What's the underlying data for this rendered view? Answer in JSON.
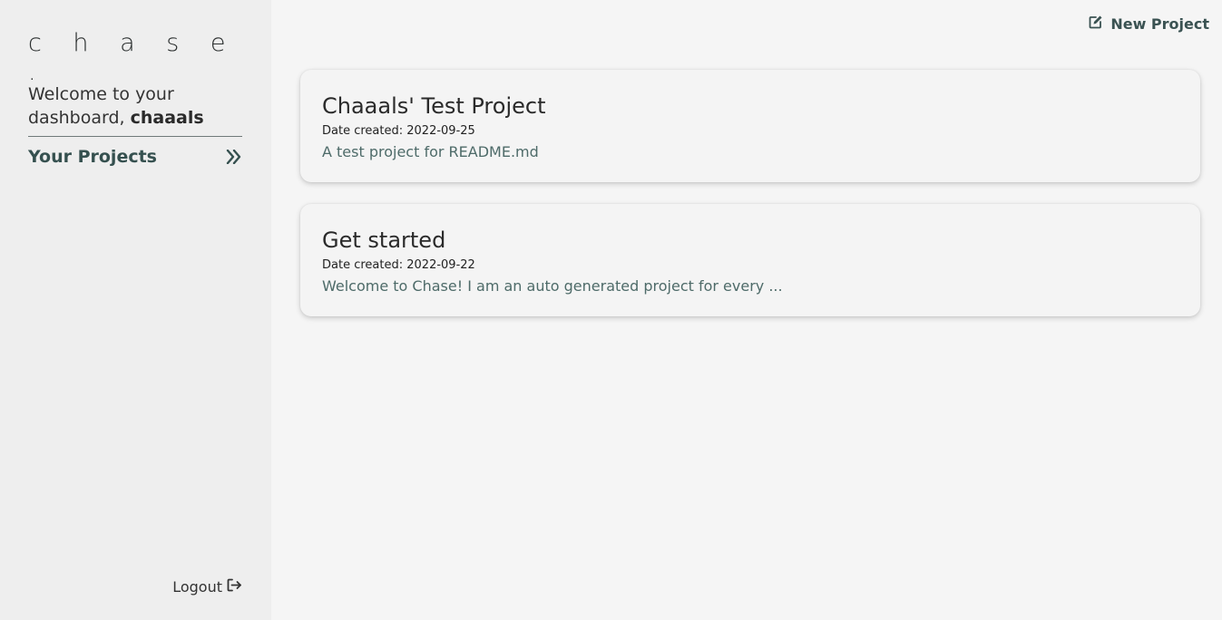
{
  "sidebar": {
    "logo": "c h a s e .",
    "welcome_prefix": "Welcome to your dashboard, ",
    "username": "chaaals",
    "projects_label": "Your Projects",
    "logout_label": "Logout"
  },
  "header": {
    "new_project_label": "New Project"
  },
  "projects": [
    {
      "title": "Chaaals' Test Project",
      "date_label": "Date created:",
      "date": "2022-09-25",
      "description": "A test project for README.md"
    },
    {
      "title": "Get started",
      "date_label": "Date created:",
      "date": "2022-09-22",
      "description": "Welcome to Chase! I am an auto generated project for every ..."
    }
  ],
  "icons": {
    "projects_arrow": "double-chevron-right-icon",
    "logout": "sign-out-icon",
    "new_project": "edit-icon"
  },
  "colors": {
    "sidebar_bg": "#eeeeee",
    "main_bg": "#f5f5f5",
    "accent": "#35504f"
  }
}
